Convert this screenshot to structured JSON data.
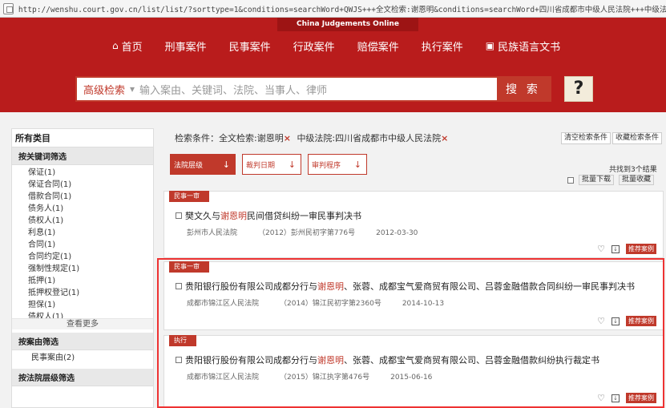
{
  "browser": {
    "url": "http://wenshu.court.gov.cn/list/list/?sorttype=1&conditions=searchWord+QWJS+++全文检索:谢恩明&conditions=searchWord+四川省成都市中级人民法院+++中级法院:四川省成都市中"
  },
  "header": {
    "brand": "China Judgements Online",
    "nav": [
      {
        "label": "首页",
        "icon": "home-icon"
      },
      {
        "label": "刑事案件"
      },
      {
        "label": "民事案件"
      },
      {
        "label": "行政案件"
      },
      {
        "label": "赔偿案件"
      },
      {
        "label": "执行案件"
      },
      {
        "label": "民族语言文书",
        "icon": "bookmark-icon"
      }
    ]
  },
  "search": {
    "advanced_label": "高级检索",
    "separator": "▾",
    "placeholder": "输入案由、关键词、法院、当事人、律师",
    "button": "搜 索",
    "help": "?"
  },
  "sidebar": {
    "title": "所有类目",
    "keyword_section": "按关键词筛选",
    "keywords": [
      "保证(1)",
      "保证合同(1)",
      "借款合同(1)",
      "债务人(1)",
      "债权人(1)",
      "利息(1)",
      "合同(1)",
      "合同约定(1)",
      "强制性规定(1)",
      "抵押(1)",
      "抵押权登记(1)",
      "担保(1)",
      "债权人(1)"
    ],
    "more": "查看更多",
    "cause_section": "按案由筛选",
    "causes": [
      "民事案由(2)"
    ],
    "court_section": "按法院层级筛选"
  },
  "criteria": {
    "label": "检索条件：全文检索:谢恩明",
    "court": "中级法院:四川省成都市中级人民法院",
    "x": "×",
    "clear": "清空检索条件",
    "save": "收藏检索条件"
  },
  "sort": {
    "buttons": [
      "法院层级",
      "裁判日期",
      "审判程序"
    ],
    "arrow": "↓"
  },
  "results": {
    "found": "共找到3个结果",
    "batch_download": "批量下载",
    "batch_save": "批量收藏",
    "recommend": "推荐案例",
    "items": [
      {
        "tag": "民事一审",
        "title_pre": "樊文久与",
        "title_hl": "谢恩明",
        "title_post": "民间借贷纠纷一审民事判决书",
        "court": "彭州市人民法院",
        "case_no": "（2012）彭州民初字第776号",
        "date": "2012-03-30"
      },
      {
        "tag": "民事一审",
        "title_pre": "贵阳银行股份有限公司成都分行与",
        "title_hl": "谢恩明",
        "title_post": "、张蓉、成都宝气爱商贸有限公司、吕蓉金融借款合同纠纷一审民事判决书",
        "court": "成都市锦江区人民法院",
        "case_no": "（2014）锦江民初字第2360号",
        "date": "2014-10-13"
      },
      {
        "tag": "执行",
        "title_pre": "贵阳银行股份有限公司成都分行与",
        "title_hl": "谢恩明",
        "title_post": "、张蓉、成都宝气爱商贸有限公司、吕蓉金融借款纠纷执行裁定书",
        "court": "成都市锦江区人民法院",
        "case_no": "（2015）锦江执字第476号",
        "date": "2015-06-16"
      }
    ]
  }
}
